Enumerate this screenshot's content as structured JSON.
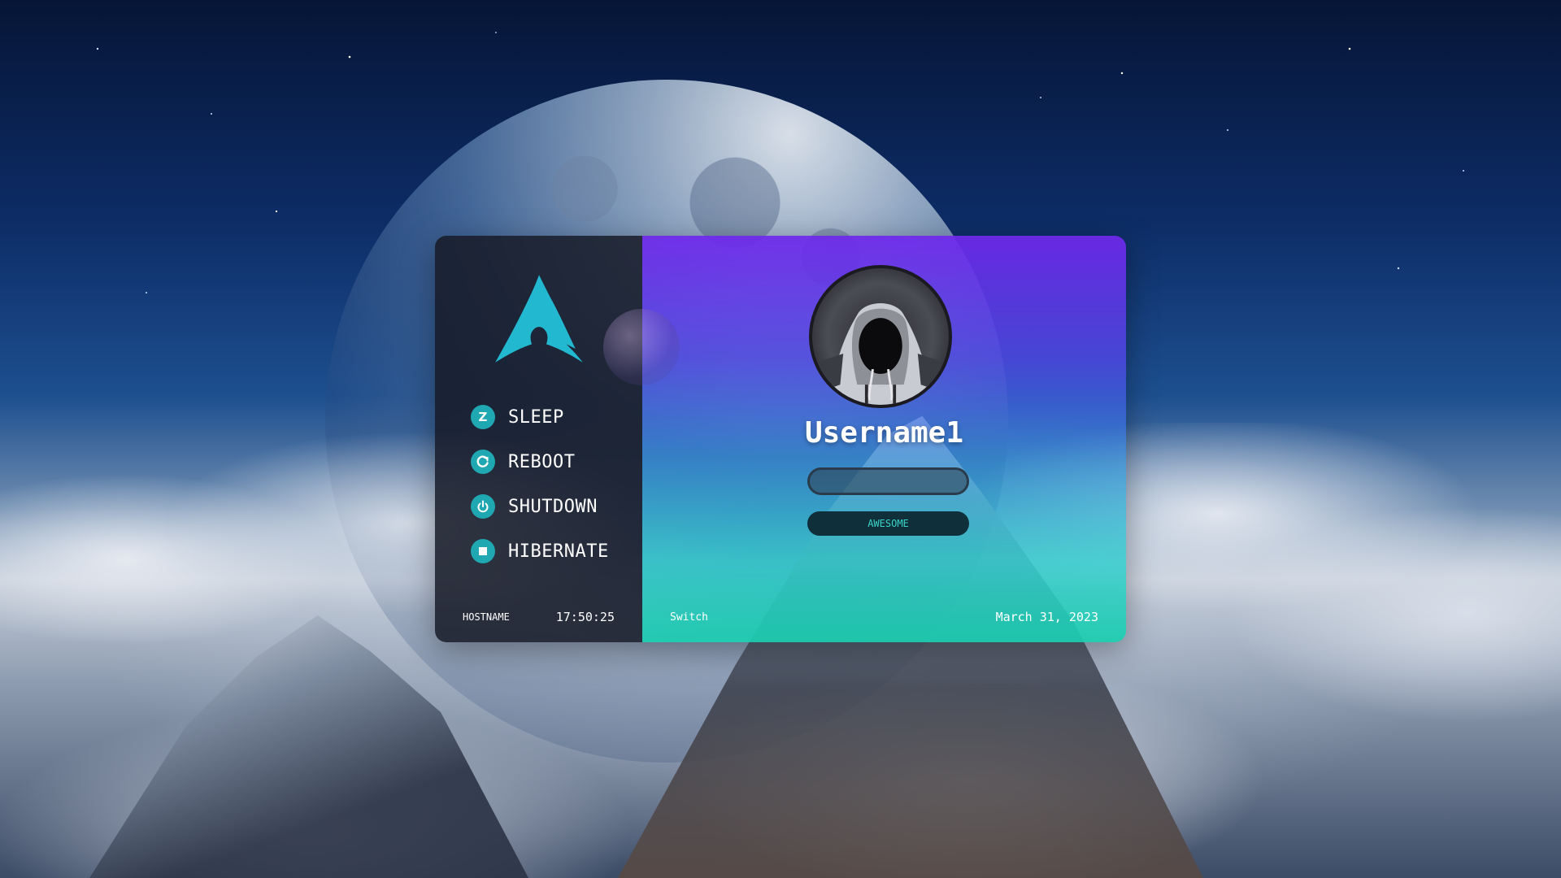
{
  "menu": {
    "items": [
      {
        "label": "SLEEP",
        "icon": "sleep-icon",
        "glyph": "Z"
      },
      {
        "label": "REBOOT",
        "icon": "reboot-icon"
      },
      {
        "label": "SHUTDOWN",
        "icon": "power-icon"
      },
      {
        "label": "HIBERNATE",
        "icon": "hibernate-icon"
      }
    ]
  },
  "footer": {
    "hostname": "HOSTNAME",
    "time": "17:50:25",
    "switch_label": "Switch",
    "date": "March 31, 2023"
  },
  "user": {
    "name": "Username1",
    "password_value": ""
  },
  "session": {
    "label": "AWESOME"
  },
  "colors": {
    "accent": "#1fa7b2",
    "session_text": "#39d5c8",
    "panel_top": "#6e28eb",
    "panel_bottom": "#19cdaf",
    "sidebar": "#161a26"
  }
}
